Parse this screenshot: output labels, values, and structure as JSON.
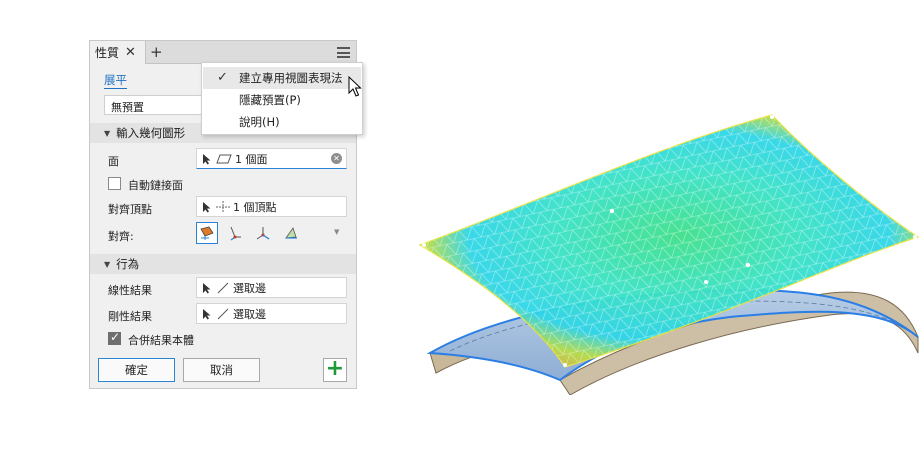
{
  "panel": {
    "tab_title": "性質",
    "tab_close": "✕",
    "tab_add": "+",
    "link_tab": "展平",
    "preset": "無預置",
    "section_input": "輸入幾何圖形",
    "face_label": "面",
    "face_value": "1 個面",
    "auto_chain_label": "自動鏈接面",
    "align_vertex_label": "對齊頂點",
    "align_vertex_value": "1 個頂點",
    "align_label": "對齊:",
    "section_behavior": "行為",
    "linear_result_label": "線性結果",
    "linear_result_value": "選取邊",
    "rigid_result_label": "剛性結果",
    "rigid_result_value": "選取邊",
    "merge_label": "合併結果本體",
    "ok": "確定",
    "cancel": "取消"
  },
  "menu": {
    "items": [
      {
        "label": "建立專用視圖表現法",
        "checked": true
      },
      {
        "label": "隱藏預置(P)",
        "checked": false
      },
      {
        "label": "說明(H)",
        "checked": false
      }
    ]
  },
  "colors": {
    "accent": "#2a84d4",
    "add_green": "#1f9a3a",
    "link_blue": "#1f72c4"
  }
}
